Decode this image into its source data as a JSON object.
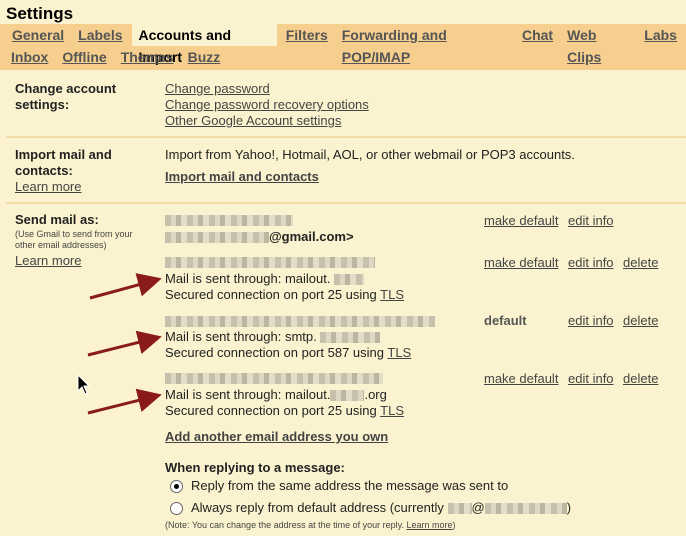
{
  "title": "Settings",
  "tabs_row1": [
    "General",
    "Labels",
    "Accounts and Import",
    "Filters",
    "Forwarding and POP/IMAP",
    "Chat",
    "Web Clips",
    "Labs"
  ],
  "tabs_row2": [
    "Inbox",
    "Offline",
    "Themes",
    "Buzz"
  ],
  "change_account": {
    "label_line1": "Change account",
    "label_line2": "settings:",
    "links": [
      "Change password",
      "Change password recovery options",
      "Other Google Account settings"
    ]
  },
  "import": {
    "label_line1": "Import mail and",
    "label_line2": "contacts:",
    "learn_more": "Learn more",
    "description": "Import from Yahoo!, Hotmail, AOL, or other webmail or POP3 accounts.",
    "action_link": "Import mail and contacts"
  },
  "send_as": {
    "label": "Send mail as:",
    "note_line1": "(Use Gmail to send from your",
    "note_line2": "other email addresses)",
    "learn_more": "Learn more",
    "primary_email_suffix": "@gmail.com>",
    "accounts": [
      {
        "sent_through": "Mail is sent through: mailout.",
        "secured": "Secured connection on port 25 using",
        "tls": "TLS",
        "status_link": "make default",
        "edit": "edit info",
        "delete": "delete"
      },
      {
        "sent_through": "Mail is sent through: smtp.",
        "secured": "Secured connection on port 587 using",
        "tls": "TLS",
        "status": "default",
        "edit": "edit info",
        "delete": "delete"
      },
      {
        "sent_through": "Mail is sent through: mailout.",
        "sent_through_tail": ".org",
        "secured": "Secured connection on port 25 using",
        "tls": "TLS",
        "status_link": "make default",
        "edit": "edit info",
        "delete": "delete"
      }
    ],
    "primary_actions": {
      "make_default": "make default",
      "edit": "edit info"
    },
    "add_link": "Add another email address you own"
  },
  "replying": {
    "heading": "When replying to a message:",
    "option1": "Reply from the same address the message was sent to",
    "option2_prefix": "Always reply from default address (currently",
    "option2_at": "@",
    "option2_suffix": ")",
    "note": "(Note: You can change the address at the time of your reply.",
    "note_link": "Learn more",
    "note_end": ")"
  },
  "colors": {
    "tab_bar": "#f6ce8e",
    "panel": "#fbf3cf",
    "arrow": "#8b1a1a"
  }
}
